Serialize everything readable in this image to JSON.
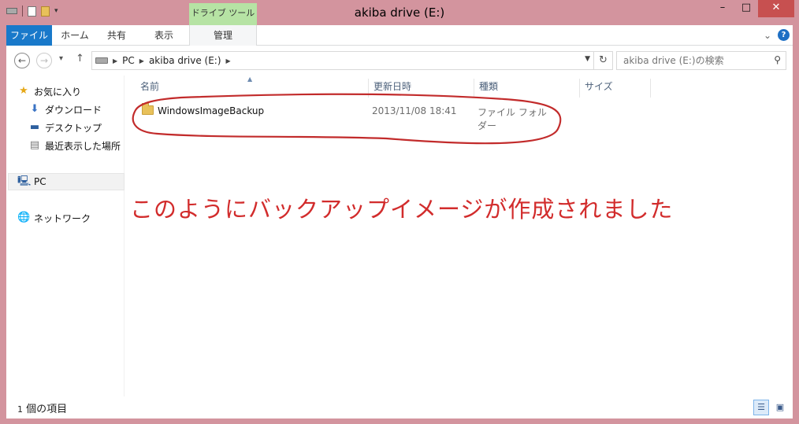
{
  "window": {
    "title": "akiba drive (E:)",
    "controls": {
      "minimize": "–",
      "maximize": "□",
      "close": "✕"
    }
  },
  "ribbon": {
    "context_group": "ドライブ ツール",
    "tabs": [
      {
        "label": "ファイル",
        "active": true
      },
      {
        "label": "ホーム"
      },
      {
        "label": "共有"
      },
      {
        "label": "表示"
      },
      {
        "label": "管理"
      }
    ]
  },
  "address": {
    "breadcrumb": [
      "PC",
      "akiba drive (E:)"
    ],
    "search_placeholder": "akiba drive (E:)の検索"
  },
  "nav_pane": {
    "favorites": {
      "label": "お気に入り",
      "children": [
        "ダウンロード",
        "デスクトップ",
        "最近表示した場所"
      ]
    },
    "pc": "PC",
    "network": "ネットワーク"
  },
  "columns": {
    "name": "名前",
    "date": "更新日時",
    "type": "種類",
    "size": "サイズ"
  },
  "files": [
    {
      "name": "WindowsImageBackup",
      "date": "2013/11/08 18:41",
      "type": "ファイル フォルダー"
    }
  ],
  "annotation": {
    "text": "このようにバックアップイメージが作成されました",
    "color": "#d22c2c"
  },
  "status": {
    "count": "1",
    "count_suffix": "個の項目"
  },
  "colors": {
    "frame": "#d3949e",
    "file_tab": "#1979ca",
    "context_tab": "#b6e3a4"
  }
}
